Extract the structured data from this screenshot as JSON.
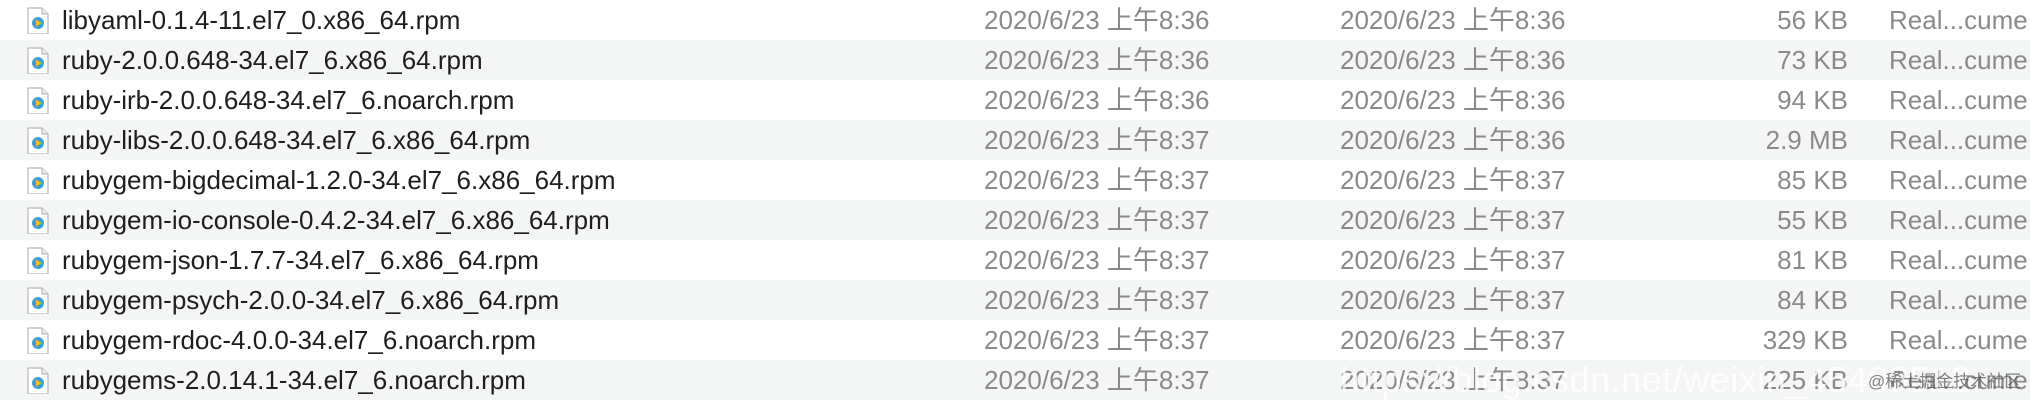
{
  "files": [
    {
      "name": "libyaml-0.1.4-11.el7_0.x86_64.rpm",
      "created": "2020/6/23 上午8:36",
      "modified": "2020/6/23 上午8:36",
      "size": "56 KB",
      "kind": "Real...cume"
    },
    {
      "name": "ruby-2.0.0.648-34.el7_6.x86_64.rpm",
      "created": "2020/6/23 上午8:36",
      "modified": "2020/6/23 上午8:36",
      "size": "73 KB",
      "kind": "Real...cume"
    },
    {
      "name": "ruby-irb-2.0.0.648-34.el7_6.noarch.rpm",
      "created": "2020/6/23 上午8:36",
      "modified": "2020/6/23 上午8:36",
      "size": "94 KB",
      "kind": "Real...cume"
    },
    {
      "name": "ruby-libs-2.0.0.648-34.el7_6.x86_64.rpm",
      "created": "2020/6/23 上午8:37",
      "modified": "2020/6/23 上午8:36",
      "size": "2.9 MB",
      "kind": "Real...cume"
    },
    {
      "name": "rubygem-bigdecimal-1.2.0-34.el7_6.x86_64.rpm",
      "created": "2020/6/23 上午8:37",
      "modified": "2020/6/23 上午8:37",
      "size": "85 KB",
      "kind": "Real...cume"
    },
    {
      "name": "rubygem-io-console-0.4.2-34.el7_6.x86_64.rpm",
      "created": "2020/6/23 上午8:37",
      "modified": "2020/6/23 上午8:37",
      "size": "55 KB",
      "kind": "Real...cume"
    },
    {
      "name": "rubygem-json-1.7.7-34.el7_6.x86_64.rpm",
      "created": "2020/6/23 上午8:37",
      "modified": "2020/6/23 上午8:37",
      "size": "81 KB",
      "kind": "Real...cume"
    },
    {
      "name": "rubygem-psych-2.0.0-34.el7_6.x86_64.rpm",
      "created": "2020/6/23 上午8:37",
      "modified": "2020/6/23 上午8:37",
      "size": "84 KB",
      "kind": "Real...cume"
    },
    {
      "name": "rubygem-rdoc-4.0.0-34.el7_6.noarch.rpm",
      "created": "2020/6/23 上午8:37",
      "modified": "2020/6/23 上午8:37",
      "size": "329 KB",
      "kind": "Real...cume"
    },
    {
      "name": "rubygems-2.0.14.1-34.el7_6.noarch.rpm",
      "created": "2020/6/23 上午8:37",
      "modified": "2020/6/23 上午8:37",
      "size": "225 KB",
      "kind": "Real...cume"
    }
  ],
  "file_icon": "realplayer-document-icon",
  "watermark": {
    "text": "https://blog.csdn.net/weixin_45409512",
    "small_text": "@稀土掘金技术社区"
  }
}
